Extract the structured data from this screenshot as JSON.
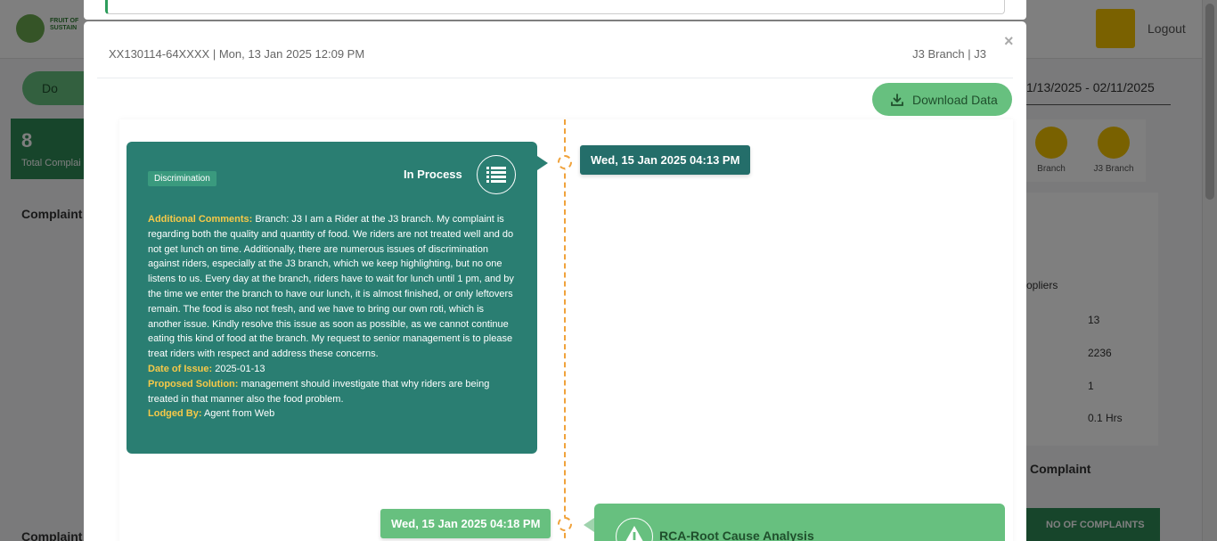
{
  "background": {
    "logo_text": [
      "FRUIT OF",
      "SUSTAIN"
    ],
    "logout_label": "Logout",
    "download_label": "Do",
    "total_count": "8",
    "total_label": "Total Complai",
    "complaint_heading": "Complaint",
    "date_range": "1/13/2025 - 02/11/2025",
    "branches": [
      {
        "label": "Branch"
      },
      {
        "label": "J3 Branch"
      }
    ],
    "suppliers_label": "opliers",
    "values": [
      "13",
      "2236",
      "1",
      "0.1 Hrs"
    ],
    "complaint_right": "Complaint",
    "no_of_complaints": "NO OF COMPLAINTS",
    "complaint_bottom": "Complaint"
  },
  "modal": {
    "title": "XX130114-64XXXX | Mon, 13 Jan 2025 12:09 PM",
    "branch": "J3 Branch | J3",
    "close": "×",
    "download_button": "Download Data"
  },
  "timeline": {
    "events": [
      {
        "date": "Wed, 15 Jan 2025 04:13 PM",
        "tag": "Discrimination",
        "status": "In Process",
        "additional_comments_label": "Additional Comments:",
        "additional_comments": "Branch: J3 I am a Rider at the J3 branch. My complaint is regarding both the quality and quantity of food. We riders are not treated well and do not get lunch on time. Additionally, there are numerous issues of discrimination against riders, especially at the J3 branch, which we keep highlighting, but no one listens to us. Every day at the branch, riders have to wait for lunch until 1 pm, and by the time we enter the branch to have our lunch, it is almost finished, or only leftovers remain. The food is also not fresh, and we have to bring our own roti, which is another issue. Kindly resolve this issue as soon as possible, as we cannot continue eating this kind of food at the branch. My request to senior management is to please treat riders with respect and address these concerns.",
        "date_of_issue_label": "Date of Issue:",
        "date_of_issue": "2025-01-13",
        "proposed_solution_label": "Proposed Solution:",
        "proposed_solution": "management should investigate that why riders are being treated in that manner also the food problem.",
        "lodged_by_label": "Lodged By:",
        "lodged_by": "Agent from Web"
      },
      {
        "date": "Wed, 15 Jan 2025 04:18 PM",
        "title": "RCA-Root Cause Analysis"
      }
    ]
  },
  "colors": {
    "card_teal": "#2a7e72",
    "accent_green": "#67c07f",
    "highlight_yellow": "#f7c948",
    "timeline_orange": "#f0a23b"
  },
  "icons": [
    "download-icon",
    "list-icon",
    "warning-icon",
    "close-icon"
  ]
}
